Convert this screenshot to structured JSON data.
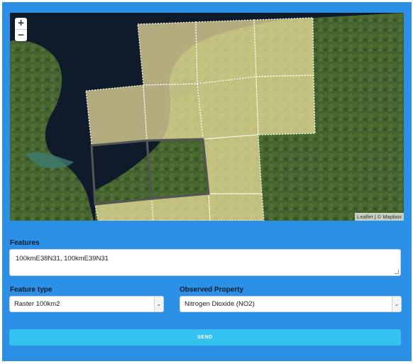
{
  "map": {
    "zoom_in_label": "+",
    "zoom_out_label": "−",
    "attribution_leaflet": "Leaflet",
    "attribution_separator": " | © ",
    "attribution_mapbox": "Mapbox",
    "selected_tiles": [
      "100kmE38N31",
      "100kmE39N31"
    ]
  },
  "form": {
    "features_label": "Features",
    "features_value": "100kmE38N31, 100kmE39N31",
    "feature_type_label": "Feature type",
    "feature_type_value": "Raster 100km2",
    "observed_property_label": "Observed Property",
    "observed_property_value": "Nitrogen Dioxide (NO2)",
    "send_label": "SEND"
  },
  "colors": {
    "panel": "#2b90e6",
    "send_button": "#34c3f0",
    "tile_fill": "#f2e4a0"
  },
  "icons": {
    "select_arrow": "chevron-down-icon"
  }
}
